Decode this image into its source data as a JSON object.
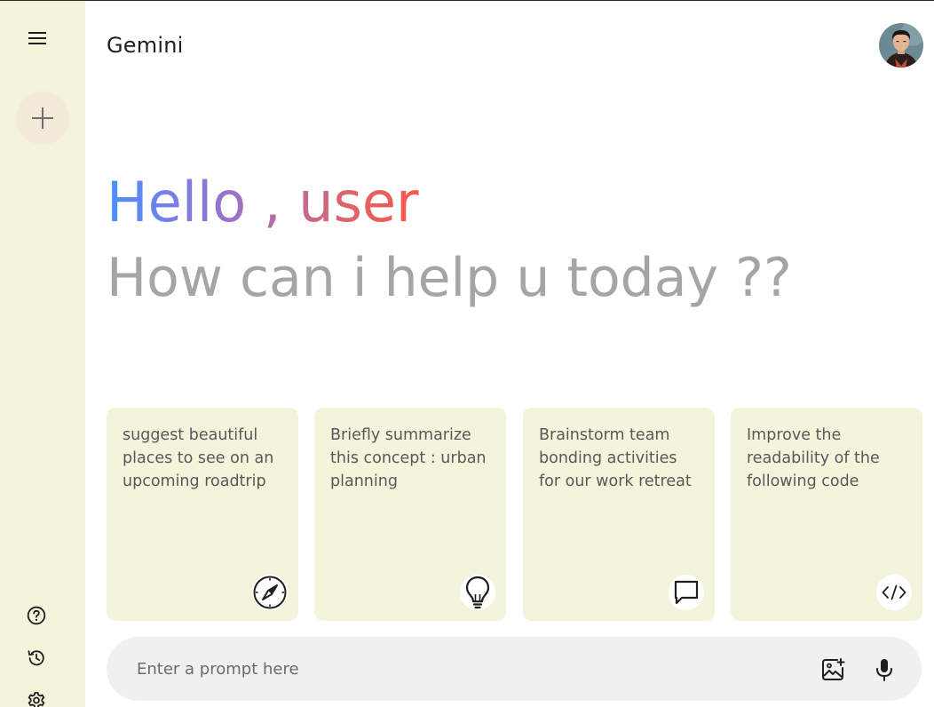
{
  "header": {
    "title": "Gemini"
  },
  "greeting": {
    "hello": "Hello , user",
    "subtitle": "How can i help u today ??"
  },
  "cards": [
    {
      "text": "suggest beautiful places to see on an upcoming roadtrip",
      "icon": "compass-icon"
    },
    {
      "text": "Briefly summarize this concept : urban planning",
      "icon": "lightbulb-icon"
    },
    {
      "text": "Brainstorm team bonding activities for our work retreat",
      "icon": "message-icon"
    },
    {
      "text": "Improve the readability of the following code",
      "icon": "code-icon"
    }
  ],
  "prompt": {
    "placeholder": "Enter a prompt here"
  },
  "sidebar": {
    "icons": [
      "menu-icon",
      "plus-icon",
      "help-icon",
      "history-icon",
      "settings-icon"
    ]
  },
  "colors": {
    "sidebar_bg": "#f4f4dc",
    "card_bg": "#f4f4dc",
    "prompt_bg": "#f0f0f0",
    "subtitle": "#a5a5a5",
    "gradient": [
      "#4b90ff",
      "#9b72cb",
      "#d96570",
      "#ff5546"
    ]
  }
}
